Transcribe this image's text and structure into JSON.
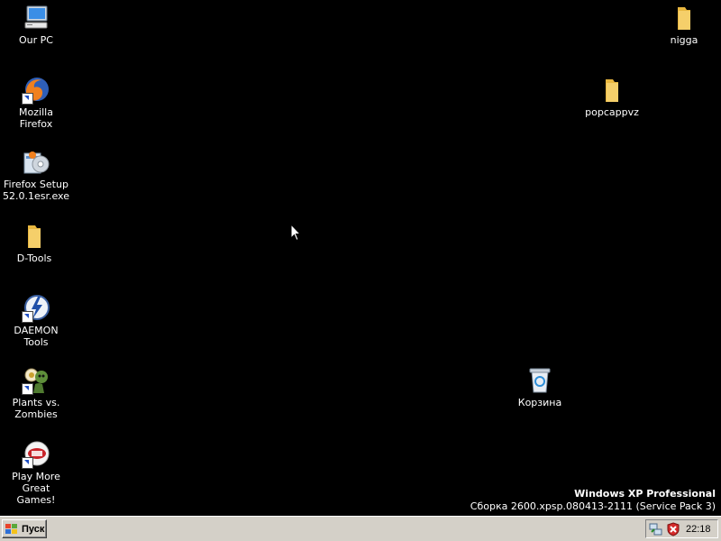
{
  "desktop": {
    "icons": [
      {
        "label": "Our PC",
        "icon": "my-computer-icon"
      },
      {
        "label": "Mozilla Firefox",
        "icon": "firefox-icon"
      },
      {
        "label": "Firefox Setup\n52.0.1esr.exe",
        "icon": "firefox-setup-icon"
      },
      {
        "label": "D-Tools",
        "icon": "folder-icon"
      },
      {
        "label": "DAEMON Tools",
        "icon": "daemon-tools-icon"
      },
      {
        "label": "Plants vs.\nZombies",
        "icon": "plants-vs-zombies-icon"
      },
      {
        "label": "Play More\nGreat Games!",
        "icon": "popcap-icon"
      },
      {
        "label": "nigga",
        "icon": "folder-icon"
      },
      {
        "label": "popcappvz",
        "icon": "folder-icon"
      },
      {
        "label": "Корзина",
        "icon": "recycle-bin-icon"
      }
    ]
  },
  "watermark": {
    "os_name": "Windows XP Professional",
    "build": "Сборка 2600.xpsp.080413-2111 (Service Pack 3)"
  },
  "taskbar": {
    "start_label": "Пуск",
    "clock": "22:18",
    "tray_icons": [
      "network-icon",
      "security-shield-icon"
    ]
  },
  "colors": {
    "desktop_background": "#000000",
    "taskbar": "#d4d0c8",
    "folder": "#f5cf6a"
  }
}
